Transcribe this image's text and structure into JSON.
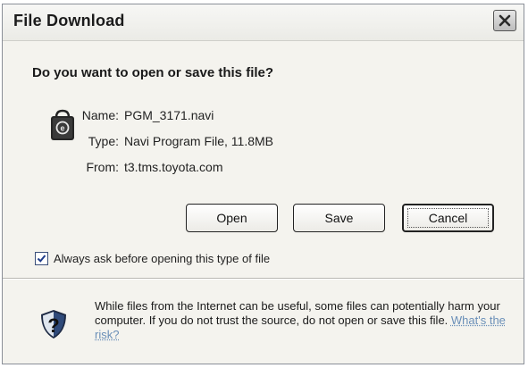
{
  "window": {
    "title": "File Download",
    "close_icon": "close-x-icon"
  },
  "prompt": {
    "question": "Do you want to open or save this file?"
  },
  "file": {
    "icon": "navi-program-file-icon",
    "name_label": "Name:",
    "name_value": "PGM_3171.navi",
    "type_label": "Type:",
    "type_value": "Navi Program File, 11.8MB",
    "from_label": "From:",
    "from_value": "t3.tms.toyota.com"
  },
  "buttons": {
    "open": "Open",
    "save": "Save",
    "cancel": "Cancel"
  },
  "always_ask": {
    "label": "Always ask before opening this type of file",
    "checked": true
  },
  "warning": {
    "icon": "security-shield-question-icon",
    "text": "While files from the Internet can be useful, some files can potentially harm your computer. If you do not trust the source, do not open or save this file.",
    "link": "What's the risk?"
  }
}
